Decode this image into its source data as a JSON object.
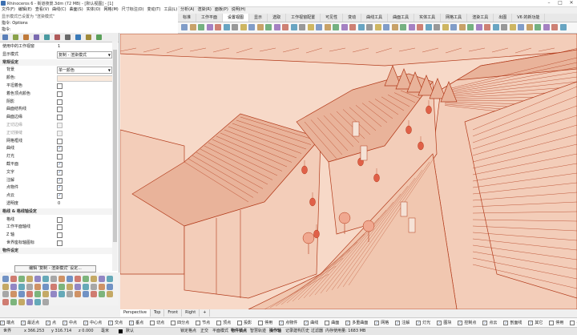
{
  "window": {
    "title": "Rhinoceros 6 - 街道夜景.3dm (72 MB) - [默认视图] - [1]",
    "minimize_icon": "minimize-icon",
    "maximize_icon": "maximize-icon",
    "close_icon": "close-icon"
  },
  "menu": [
    "文件(F)",
    "编辑(E)",
    "查看(V)",
    "曲线(C)",
    "曲面(S)",
    "实体(O)",
    "网格(M)",
    "尺寸标注(D)",
    "变动(T)",
    "工具(L)",
    "分析(A)",
    "渲染(R)",
    "面板(P)",
    "说明(H)"
  ],
  "command": {
    "history": "显示模式已设置为 \"渲染模式\"",
    "prompt1": "指令: Options",
    "prompt2": "指令:"
  },
  "toolbar_tabs": [
    "标准",
    "工作平面",
    "设置视图",
    "显示",
    "选取",
    "工作视窗配置",
    "可见性",
    "变动",
    "曲线工具",
    "曲面工具",
    "实体工具",
    "网格工具",
    "渲染工具",
    "出图",
    "V6 的新功能"
  ],
  "toolbar_active": "设置视图",
  "panel": {
    "rows": [
      {
        "label": "使用中的工作视窗",
        "value": "1"
      },
      {
        "label": "显示模式",
        "value": "复制 - 渲染模式"
      },
      {
        "section": "常规设定"
      },
      {
        "label": "背景",
        "value": "单一颜色"
      },
      {
        "label": "颜色:"
      },
      {
        "label": "平坦着色",
        "check": false
      },
      {
        "label": "着色顶点颜色",
        "check": false
      },
      {
        "label": "阴影",
        "check": false
      },
      {
        "label": "曲面结构线",
        "check": false
      },
      {
        "label": "曲面边缘",
        "check": false
      },
      {
        "label": "正切边缘",
        "check": false,
        "disabled": true
      },
      {
        "label": "正切接缝",
        "check": false,
        "disabled": true
      },
      {
        "label": "网格框线",
        "check": false
      },
      {
        "label": "曲线",
        "check": true
      },
      {
        "label": "灯光",
        "check": false
      },
      {
        "label": "截平面",
        "check": true
      },
      {
        "label": "文字",
        "check": true
      },
      {
        "label": "注解",
        "check": true
      },
      {
        "label": "点物件",
        "check": true
      },
      {
        "label": "点云",
        "check": true
      },
      {
        "label": "透明度",
        "value": "0"
      },
      {
        "section": "格线 & 格线轴设定"
      },
      {
        "label": "格线",
        "check": false
      },
      {
        "label": "工作平面轴线",
        "check": false
      },
      {
        "label": "Z 轴",
        "check": false
      },
      {
        "label": "世界座标轴图标",
        "check": false
      },
      {
        "section": "物件设定"
      }
    ],
    "modify_button": "编辑 '复制 - 渲染模式' 设定..."
  },
  "viewport_tabs": [
    "Perspective",
    "Top",
    "Front",
    "Right"
  ],
  "viewport_active": "Perspective",
  "osnap": {
    "items": [
      {
        "label": "端点",
        "on": true
      },
      {
        "label": "最近点",
        "on": true
      },
      {
        "label": "点",
        "on": true
      },
      {
        "label": "中点",
        "on": true
      },
      {
        "label": "中心点",
        "on": true
      },
      {
        "label": "交点",
        "on": true
      },
      {
        "label": "垂点",
        "on": true
      },
      {
        "label": "切点",
        "on": false
      },
      {
        "label": "四分点",
        "on": false
      },
      {
        "label": "节点",
        "on": false
      },
      {
        "label": "顶点",
        "on": false
      },
      {
        "label": "投影",
        "on": false
      },
      {
        "label": "停用",
        "on": false
      }
    ],
    "filters": [
      {
        "label": "点物件",
        "on": true
      },
      {
        "label": "曲线",
        "on": true
      },
      {
        "label": "曲面",
        "on": false
      },
      {
        "label": "多重曲面",
        "on": true
      },
      {
        "label": "网格",
        "on": true
      },
      {
        "label": "注解",
        "on": true
      },
      {
        "label": "灯光",
        "on": true
      },
      {
        "label": "图块",
        "on": true
      },
      {
        "label": "控制点",
        "on": true
      },
      {
        "label": "点云",
        "on": true
      },
      {
        "label": "剖面线",
        "on": true
      },
      {
        "label": "其它",
        "on": true
      },
      {
        "label": "停用",
        "on": false
      },
      {
        "label": "子物件",
        "on": false
      }
    ]
  },
  "status": {
    "cplane": "世界",
    "x": "x 366.253",
    "y": "y 316.714",
    "z": "z 0.000",
    "units": "毫米",
    "layer": "默认",
    "lock_grid": "锁定格点",
    "ortho": "正交",
    "planar": "平面模式",
    "osnap": "物件锁点",
    "smarttrack": "智慧轨迹",
    "gumball": "操作轴",
    "record_history": "记录建构历史",
    "filter": "过滤器",
    "memory": "内存使用量: 1683 MB"
  },
  "colors": {
    "viewport_bg": "#f7d9c8",
    "line": "#b23a1a",
    "fill_light": "#f3cdb9",
    "fill_dark": "#e9b39a",
    "lantern": "#e06048"
  }
}
